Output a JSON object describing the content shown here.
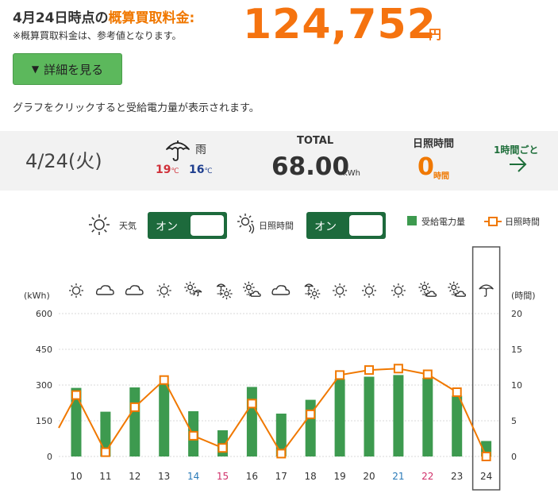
{
  "header": {
    "title_prefix": "4月24日時点の",
    "title_accent": "概算買取料金:",
    "note": "※概算買取料金は、参考値となります。",
    "amount": "124,752",
    "amount_unit": "円"
  },
  "detail_button": {
    "arrow": "▼",
    "label": "詳細を見る"
  },
  "hint": "グラフをクリックすると受給電力量が表示されます。",
  "summary": {
    "date": "4/24(火)",
    "weather_label": "雨",
    "temp_high": "19",
    "temp_low": "16",
    "temp_unit": "℃",
    "total_label": "TOTAL",
    "total_value": "68.00",
    "total_unit": "kWh",
    "sunshine_label": "日照時間",
    "sunshine_value": "0",
    "sunshine_unit": "時間",
    "hourly_link": "1時間ごと"
  },
  "controls": {
    "weather_label": "天気",
    "weather_toggle": "オン",
    "sunshine_label": "日照時間",
    "sunshine_toggle": "オン",
    "legend_power": "受給電力量",
    "legend_sunshine": "日照時間"
  },
  "colors": {
    "accent_orange": "#f5730f",
    "bar_green": "#3d9a4f",
    "toggle_green": "#1d6a3c",
    "saturday_blue": "#2a7ab8",
    "sunday_red": "#d0316a"
  },
  "chart_data": {
    "type": "bar",
    "categories": [
      "10",
      "11",
      "12",
      "13",
      "14",
      "15",
      "16",
      "17",
      "18",
      "19",
      "20",
      "21",
      "22",
      "23",
      "24"
    ],
    "weekday_type": [
      "weekday",
      "weekday",
      "weekday",
      "weekday",
      "saturday",
      "sunday",
      "weekday",
      "weekday",
      "weekday",
      "weekday",
      "weekday",
      "saturday",
      "sunday",
      "weekday",
      "weekday"
    ],
    "weather_icons": [
      "sun-icon",
      "cloud-icon",
      "cloud-icon",
      "sun-icon",
      "sun-then-rain-icon",
      "rain-then-sun-icon",
      "sun-then-cloud-icon",
      "cloud-icon",
      "rain-then-sun-icon",
      "sun-icon",
      "sun-icon",
      "sun-icon",
      "sun-then-cloud-icon",
      "sun-then-cloud-icon",
      "rain-icon"
    ],
    "selected_category": "24",
    "series": [
      {
        "name": "受給電力量",
        "axis": "left",
        "kind": "bar",
        "values": [
          288,
          188,
          290,
          305,
          190,
          110,
          292,
          180,
          238,
          325,
          335,
          342,
          330,
          255,
          65
        ]
      },
      {
        "name": "日照時間",
        "axis": "right",
        "kind": "line",
        "values": [
          8.6,
          0.6,
          6.9,
          10.7,
          2.9,
          1.2,
          7.4,
          0.4,
          5.9,
          11.4,
          12.1,
          12.3,
          11.5,
          9.0,
          0
        ]
      }
    ],
    "line_lead_in_from": 4.0,
    "y_left": {
      "label": "(kWh)",
      "lim": [
        0,
        600
      ],
      "ticks": [
        0,
        150,
        300,
        450,
        600
      ]
    },
    "y_right": {
      "label": "(時間)",
      "lim": [
        0,
        20
      ],
      "ticks": [
        0,
        5,
        10,
        15,
        20
      ]
    },
    "grid": true
  }
}
